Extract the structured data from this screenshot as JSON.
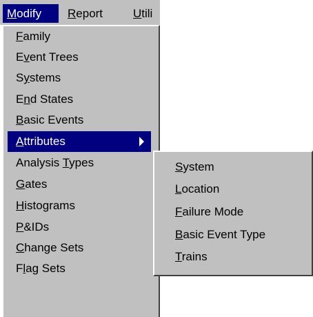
{
  "menubar": {
    "items": [
      {
        "pre": "",
        "key": "M",
        "post": "odify"
      },
      {
        "pre": "",
        "key": "R",
        "post": "eport"
      },
      {
        "pre": "",
        "key": "U",
        "post": "tili"
      }
    ]
  },
  "modify_menu": {
    "items": [
      {
        "pre": "",
        "key": "F",
        "post": "amily"
      },
      {
        "pre": "E",
        "key": "v",
        "post": "ent Trees"
      },
      {
        "pre": "S",
        "key": "y",
        "post": "stems"
      },
      {
        "pre": "E",
        "key": "n",
        "post": "d States"
      },
      {
        "pre": "",
        "key": "B",
        "post": "asic Events"
      },
      {
        "pre": "",
        "key": "A",
        "post": "ttributes"
      },
      {
        "pre": "Analysis ",
        "key": "T",
        "post": "ypes"
      },
      {
        "pre": "",
        "key": "G",
        "post": "ates"
      },
      {
        "pre": "",
        "key": "H",
        "post": "istograms"
      },
      {
        "pre": "",
        "key": "P",
        "post": "&IDs"
      },
      {
        "pre": "",
        "key": "C",
        "post": "hange Sets"
      },
      {
        "pre": "F",
        "key": "l",
        "post": "ag Sets"
      }
    ],
    "highlighted_index": 5
  },
  "attributes_submenu": {
    "items": [
      {
        "pre": "",
        "key": "S",
        "post": "ystem"
      },
      {
        "pre": "",
        "key": "L",
        "post": "ocation"
      },
      {
        "pre": "",
        "key": "F",
        "post": "ailure Mode"
      },
      {
        "pre": "",
        "key": "B",
        "post": "asic Event Type"
      },
      {
        "pre": "",
        "key": "T",
        "post": "rains"
      }
    ]
  },
  "colors": {
    "menu_face": "#c0c0c0",
    "highlight": "#000080",
    "highlight_text": "#ffffff"
  }
}
